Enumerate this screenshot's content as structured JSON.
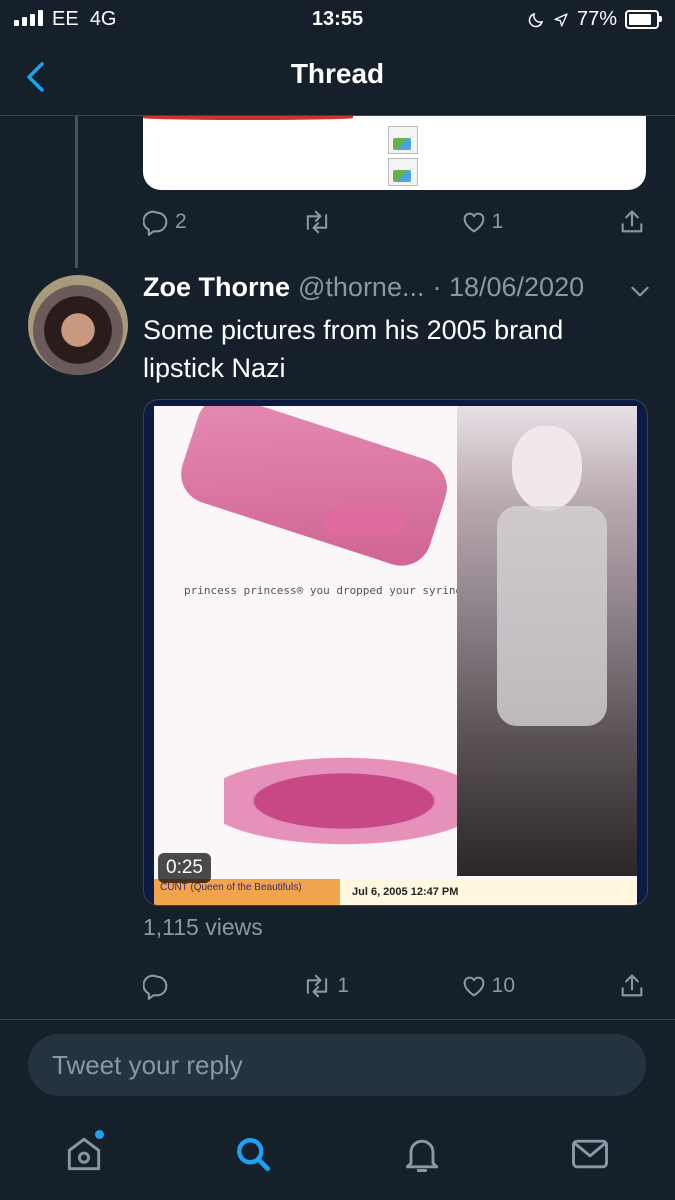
{
  "status_bar": {
    "carrier": "EE",
    "network": "4G",
    "time": "13:55",
    "battery": "77%"
  },
  "header": {
    "title": "Thread"
  },
  "previous_tweet": {
    "actions": {
      "replies": "2",
      "retweets": "",
      "likes": "1"
    }
  },
  "tweet": {
    "author_name": "Zoe Thorne",
    "author_handle": "@thorne...",
    "date": "· 18/06/2020",
    "text": "Some pictures from his 2005 brand lipstick Nazi",
    "media": {
      "caption": "princess princess® you dropped your syringe.",
      "bar_left": "CUNT (Queen of the Beautifuls)",
      "bar_right": "Jul 6, 2005 12:47 PM",
      "duration": "0:25"
    },
    "views": "1,115 views",
    "actions": {
      "replies": "",
      "retweets": "1",
      "likes": "10"
    }
  },
  "reply_box": {
    "placeholder": "Tweet your reply"
  },
  "tab_bar": {
    "items": [
      "home-icon",
      "search-icon",
      "notifications-icon",
      "messages-icon"
    ],
    "active": "search-icon"
  },
  "colors": {
    "background": "#15202b",
    "accent": "#1da1f2",
    "secondary_text": "#8899a6",
    "divider": "#38444d"
  }
}
